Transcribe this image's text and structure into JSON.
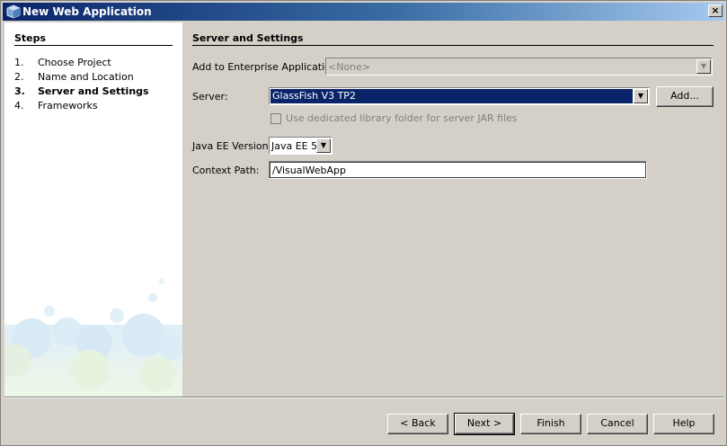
{
  "window": {
    "title": "New Web Application",
    "close_label": "×"
  },
  "steps": {
    "heading": "Steps",
    "items": [
      {
        "num": "1.",
        "label": "Choose Project"
      },
      {
        "num": "2.",
        "label": "Name and Location"
      },
      {
        "num": "3.",
        "label": "Server and Settings"
      },
      {
        "num": "4.",
        "label": "Frameworks"
      }
    ]
  },
  "content": {
    "section_title": "Server and Settings",
    "enterprise": {
      "label": "Add to Enterprise Application:",
      "value": "<None>"
    },
    "server": {
      "label": "Server:",
      "value": "GlassFish V3 TP2",
      "add_button": "Add..."
    },
    "library_checkbox": {
      "label": "Use dedicated library folder for server JAR files",
      "checked": false
    },
    "javaee": {
      "label": "Java EE Version:",
      "value": "Java EE 5"
    },
    "context_path": {
      "label": "Context Path:",
      "value": "/VisualWebApp"
    }
  },
  "buttons": {
    "back": "< Back",
    "next": "Next >",
    "finish": "Finish",
    "cancel": "Cancel",
    "help": "Help"
  }
}
